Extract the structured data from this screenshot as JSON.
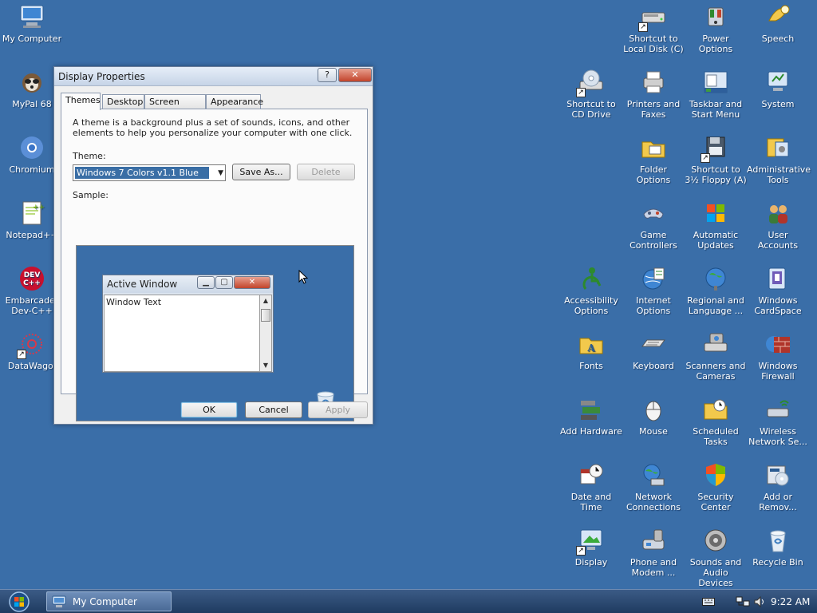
{
  "desktop_left": [
    {
      "label": "My Computer",
      "icon": "my-computer-icon",
      "shortcut": false
    },
    {
      "label": "MyPal 68",
      "icon": "mypal-icon",
      "shortcut": false
    },
    {
      "label": "Chromium",
      "icon": "chromium-icon",
      "shortcut": false
    },
    {
      "label": "Notepad++",
      "icon": "notepad-plus-plus-icon",
      "shortcut": false
    },
    {
      "label": "Embarcader Dev-C++",
      "icon": "dev-cpp-icon",
      "shortcut": false
    },
    {
      "label": "DataWago.",
      "icon": "datawago-icon",
      "shortcut": true
    }
  ],
  "desktop_right": [
    {
      "label": "Shortcut to Local Disk (C)",
      "icon": "local-disk-icon",
      "shortcut": true
    },
    {
      "label": "Power Options",
      "icon": "power-options-icon",
      "shortcut": false
    },
    {
      "label": "Speech",
      "icon": "speech-icon",
      "shortcut": false
    },
    {
      "label": "Shortcut to CD Drive",
      "icon": "cd-drive-icon",
      "shortcut": true
    },
    {
      "label": "Printers and Faxes",
      "icon": "printers-faxes-icon",
      "shortcut": false
    },
    {
      "label": "Taskbar and Start Menu",
      "icon": "taskbar-start-menu-icon",
      "shortcut": false
    },
    {
      "label": "System",
      "icon": "system-icon",
      "shortcut": false
    },
    {
      "label": "Folder Options",
      "icon": "folder-options-icon",
      "shortcut": false
    },
    {
      "label": "Shortcut to 3½ Floppy (A)",
      "icon": "floppy-icon",
      "shortcut": true
    },
    {
      "label": "Administrative Tools",
      "icon": "administrative-tools-icon",
      "shortcut": false
    },
    {
      "label": "Game Controllers",
      "icon": "game-controllers-icon",
      "shortcut": false
    },
    {
      "label": "Automatic Updates",
      "icon": "automatic-updates-icon",
      "shortcut": false
    },
    {
      "label": "User Accounts",
      "icon": "user-accounts-icon",
      "shortcut": false
    },
    {
      "label": "Accessibility Options",
      "icon": "accessibility-icon",
      "shortcut": false
    },
    {
      "label": "Internet Options",
      "icon": "internet-options-icon",
      "shortcut": false
    },
    {
      "label": "Regional and Language ...",
      "icon": "regional-language-icon",
      "shortcut": false
    },
    {
      "label": "Windows CardSpace",
      "icon": "cardspace-icon",
      "shortcut": false
    },
    {
      "label": "Fonts",
      "icon": "fonts-icon",
      "shortcut": false
    },
    {
      "label": "Keyboard",
      "icon": "keyboard-icon",
      "shortcut": false
    },
    {
      "label": "Scanners and Cameras",
      "icon": "scanners-cameras-icon",
      "shortcut": false
    },
    {
      "label": "Windows Firewall",
      "icon": "firewall-icon",
      "shortcut": false
    },
    {
      "label": "Add Hardware",
      "icon": "add-hardware-icon",
      "shortcut": false
    },
    {
      "label": "Mouse",
      "icon": "mouse-icon",
      "shortcut": false
    },
    {
      "label": "Scheduled Tasks",
      "icon": "scheduled-tasks-icon",
      "shortcut": false
    },
    {
      "label": "Wireless Network Se...",
      "icon": "wireless-network-icon",
      "shortcut": false
    },
    {
      "label": "Date and Time",
      "icon": "date-time-icon",
      "shortcut": false
    },
    {
      "label": "Network Connections",
      "icon": "network-connections-icon",
      "shortcut": false
    },
    {
      "label": "Security Center",
      "icon": "security-center-icon",
      "shortcut": false
    },
    {
      "label": "Add or Remov...",
      "icon": "add-remove-programs-icon",
      "shortcut": false
    },
    {
      "label": "Display",
      "icon": "display-icon",
      "shortcut": true
    },
    {
      "label": "Phone and Modem ...",
      "icon": "phone-modem-icon",
      "shortcut": false
    },
    {
      "label": "Sounds and Audio Devices",
      "icon": "sounds-audio-icon",
      "shortcut": false
    },
    {
      "label": "Recycle Bin",
      "icon": "recycle-bin-icon",
      "shortcut": false
    }
  ],
  "dialog": {
    "title": "Display Properties",
    "help_label": "?",
    "close_label": "✕",
    "tabs": [
      "Themes",
      "Desktop",
      "Screen Saver",
      "Appearance"
    ],
    "active_tab": "Themes",
    "description": "A theme is a background plus a set of sounds, icons, and other elements to help you personalize your computer with one click.",
    "theme_label": "Theme:",
    "theme_value": "Windows 7 Colors v1.1 Blue",
    "save_as_label": "Save As...",
    "delete_label": "Delete",
    "sample_label": "Sample:",
    "sample_window_title": "Active Window",
    "sample_window_text": "Window Text",
    "ok_label": "OK",
    "cancel_label": "Cancel",
    "apply_label": "Apply"
  },
  "taskbar": {
    "task_label": "My Computer",
    "clock": "9:22 AM"
  },
  "colors": {
    "desktop": "#3a6ea8",
    "selection": "#3a6ea5",
    "taskbar": "#2a4a75"
  }
}
